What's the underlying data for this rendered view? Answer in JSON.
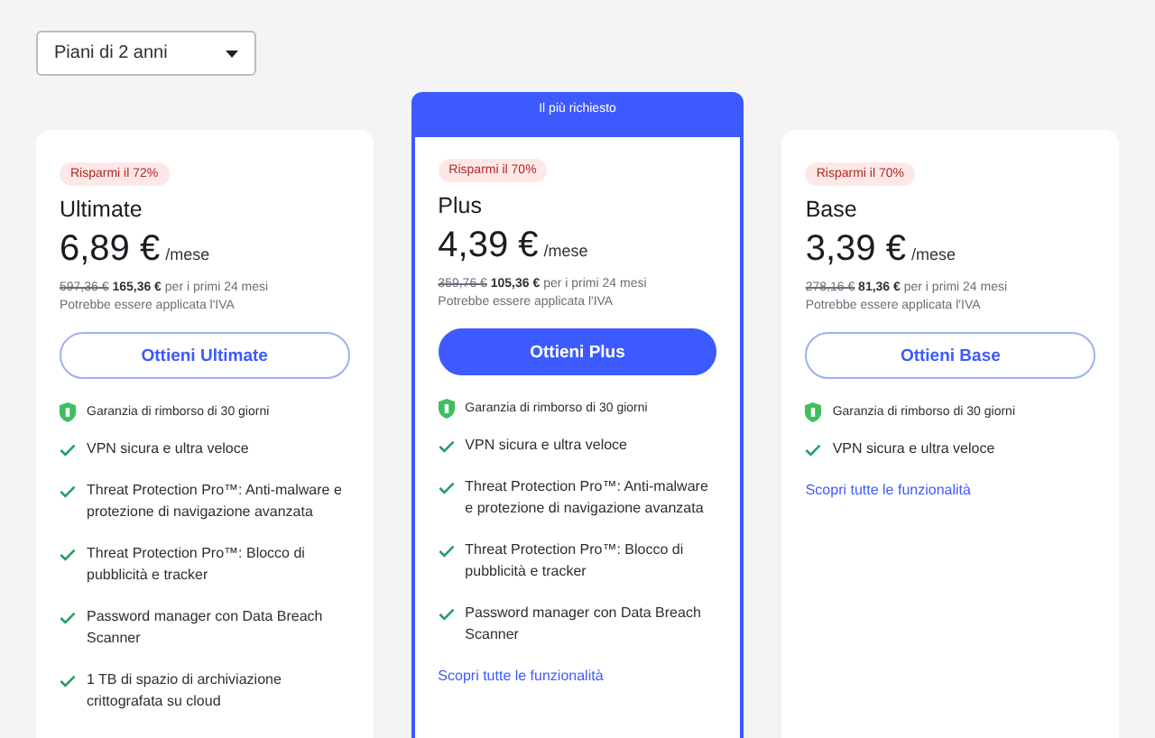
{
  "period_select": {
    "value": "Piani di 2 anni"
  },
  "plans": [
    {
      "badge": "Risparmi il 72%",
      "name": "Ultimate",
      "price": "6,89 €",
      "unit": "/mese",
      "old_price": "597,36 €",
      "total": "165,36 €",
      "period_note": "per i primi 24 mesi",
      "vat_note": "Potrebbe essere applicata l'IVA",
      "button": "Ottieni Ultimate",
      "highlighted": false,
      "guarantee": "Garanzia di rimborso di 30 giorni",
      "features": [
        "VPN sicura e ultra veloce",
        "Threat Protection Pro™: Anti-malware e protezione di navigazione avanzata",
        "Threat Protection Pro™: Blocco di pubblicità e tracker",
        "Password manager con Data Breach Scanner",
        "1 TB di spazio di archiviazione crittografata su cloud"
      ]
    },
    {
      "ribbon": "Il più richiesto",
      "badge": "Risparmi il 70%",
      "name": "Plus",
      "price": "4,39 €",
      "unit": "/mese",
      "old_price": "359,76 €",
      "total": "105,36 €",
      "period_note": "per i primi 24 mesi",
      "vat_note": "Potrebbe essere applicata l'IVA",
      "button": "Ottieni Plus",
      "highlighted": true,
      "guarantee": "Garanzia di rimborso di 30 giorni",
      "features": [
        "VPN sicura e ultra veloce",
        "Threat Protection Pro™: Anti-malware e protezione di navigazione avanzata",
        "Threat Protection Pro™: Blocco di pubblicità e tracker",
        "Password manager con Data Breach Scanner"
      ],
      "link": "Scopri tutte le funzionalità"
    },
    {
      "badge": "Risparmi il 70%",
      "name": "Base",
      "price": "3,39 €",
      "unit": "/mese",
      "old_price": "278,16 €",
      "total": "81,36 €",
      "period_note": "per i primi 24 mesi",
      "vat_note": "Potrebbe essere applicata l'IVA",
      "button": "Ottieni Base",
      "highlighted": false,
      "guarantee": "Garanzia di rimborso di 30 giorni",
      "features": [
        "VPN sicura e ultra veloce"
      ],
      "link": "Scopri tutte le funzionalità"
    }
  ]
}
